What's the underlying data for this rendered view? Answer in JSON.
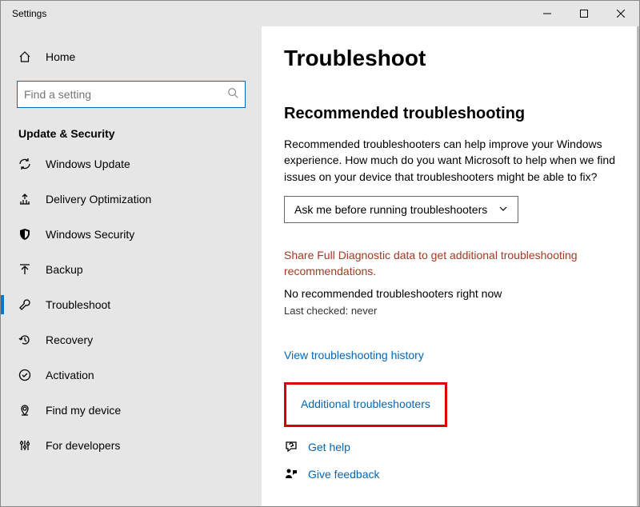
{
  "titlebar": {
    "title": "Settings"
  },
  "sidebar": {
    "home": "Home",
    "search_placeholder": "Find a setting",
    "section": "Update & Security",
    "items": [
      {
        "label": "Windows Update"
      },
      {
        "label": "Delivery Optimization"
      },
      {
        "label": "Windows Security"
      },
      {
        "label": "Backup"
      },
      {
        "label": "Troubleshoot"
      },
      {
        "label": "Recovery"
      },
      {
        "label": "Activation"
      },
      {
        "label": "Find my device"
      },
      {
        "label": "For developers"
      }
    ]
  },
  "content": {
    "title": "Troubleshoot",
    "section_title": "Recommended troubleshooting",
    "desc": "Recommended troubleshooters can help improve your Windows experience. How much do you want Microsoft to help when we find issues on your device that troubleshooters might be able to fix?",
    "dropdown_value": "Ask me before running troubleshooters",
    "warn": "Share Full Diagnostic data to get additional troubleshooting recommendations.",
    "status": "No recommended troubleshooters right now",
    "last_checked": "Last checked: never",
    "history_link": "View troubleshooting history",
    "additional_link": "Additional troubleshooters",
    "get_help": "Get help",
    "give_feedback": "Give feedback"
  }
}
